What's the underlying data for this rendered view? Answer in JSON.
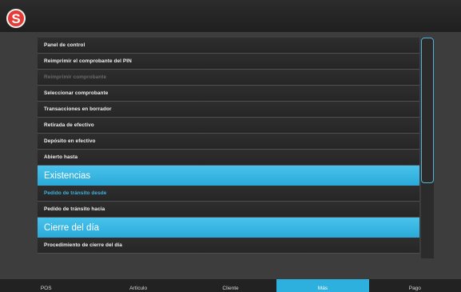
{
  "app": {
    "logo_letter": "S",
    "logo_color": "#e53a36",
    "accent_color": "#2db0de"
  },
  "menu": {
    "items": [
      {
        "type": "item",
        "label": "Panel de control",
        "state": "normal"
      },
      {
        "type": "item",
        "label": "Reimprimir el comprobante del PIN",
        "state": "normal"
      },
      {
        "type": "item",
        "label": "Reimprimir comprobante",
        "state": "disabled"
      },
      {
        "type": "item",
        "label": "Seleccionar comprobante",
        "state": "normal"
      },
      {
        "type": "item",
        "label": "Transacciones en borrador",
        "state": "normal"
      },
      {
        "type": "item",
        "label": "Retirada de efectivo",
        "state": "normal"
      },
      {
        "type": "item",
        "label": "Depósito en efectivo",
        "state": "normal"
      },
      {
        "type": "item",
        "label": "Abierto hasta",
        "state": "normal"
      },
      {
        "type": "header",
        "label": "Existencias"
      },
      {
        "type": "item",
        "label": "Pedido de tránsito desde",
        "state": "active"
      },
      {
        "type": "item",
        "label": "Pedido de tránsito hacia",
        "state": "normal"
      },
      {
        "type": "header",
        "label": "Cierre del día"
      },
      {
        "type": "item",
        "label": "Procedimiento de cierre del día",
        "state": "normal"
      }
    ]
  },
  "bottom_nav": {
    "tabs": [
      {
        "label": "POS",
        "selected": false
      },
      {
        "label": "Artículo",
        "selected": false
      },
      {
        "label": "Cliente",
        "selected": false
      },
      {
        "label": "Más",
        "selected": true
      },
      {
        "label": "Pago",
        "selected": false
      }
    ]
  }
}
